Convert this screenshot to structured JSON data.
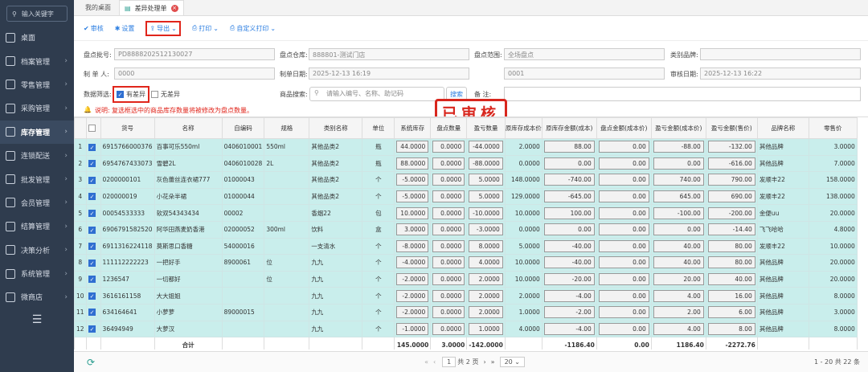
{
  "sidebar": {
    "search_placeholder": "输入关键字",
    "items": [
      {
        "label": "桌面",
        "icon": "monitor-icon",
        "chev": ""
      },
      {
        "label": "档案管理",
        "icon": "file-icon",
        "chev": "›"
      },
      {
        "label": "零售管理",
        "icon": "shop-icon",
        "chev": "›"
      },
      {
        "label": "采购管理",
        "icon": "cart-icon",
        "chev": "›"
      },
      {
        "label": "库存管理",
        "icon": "warehouse-icon",
        "chev": "›"
      },
      {
        "label": "连锁配送",
        "icon": "truck-icon",
        "chev": "›"
      },
      {
        "label": "批发管理",
        "icon": "box-icon",
        "chev": "›"
      },
      {
        "label": "会员管理",
        "icon": "user-icon",
        "chev": "›"
      },
      {
        "label": "结算管理",
        "icon": "wallet-icon",
        "chev": "›"
      },
      {
        "label": "决策分析",
        "icon": "chart-icon",
        "chev": "›"
      },
      {
        "label": "系统管理",
        "icon": "gear-icon",
        "chev": "›"
      },
      {
        "label": "微商店",
        "icon": "store-icon",
        "chev": "›"
      }
    ],
    "collapse": "☰"
  },
  "tabs": [
    {
      "label": "我的桌面"
    },
    {
      "label": "差异处理单"
    }
  ],
  "toolbar": {
    "audit": "审核",
    "settings": "设置",
    "export": "导出",
    "print": "打印",
    "custom_print": "自定义打印"
  },
  "form": {
    "batch_label": "盘点批号:",
    "batch_value": "PD8888202512130027",
    "warehouse_label": "盘点仓库:",
    "warehouse_value": "888801-测试门店",
    "range_label": "盘点范围:",
    "range_value": "全场盘点",
    "brand_label": "类别品牌:",
    "brand_value": "",
    "maker_label": "制 单 人:",
    "maker_value": "0000",
    "date_label": "制单日期:",
    "date_value": "2025-12-13 16:19",
    "auditor_value": "0001",
    "audit_date_label": "审核日期:",
    "audit_date_value": "2025-12-13 16:22",
    "filter_label": "数据筛选:",
    "has_diff": "有差异",
    "no_diff": "无差异",
    "goods_search_label": "商品搜索:",
    "goods_search_placeholder": "请输入编号、名称、助记码",
    "search_btn": "搜索",
    "remark_label": "备    注:",
    "remark_value": "",
    "note_label": "说明:",
    "note_text": "复选框选中的商品库存数量将被修改为盘点数量。",
    "stamp": "已审核"
  },
  "columns": [
    "",
    "货号",
    "名称",
    "自编码",
    "规格",
    "类别名称",
    "单位",
    "系统库存",
    "盘点数量",
    "盈亏数量",
    "原库存成本价",
    "原库存金额(成本)",
    "盘点金额(成本价)",
    "盈亏金额(成本价)",
    "盈亏金额(售价)",
    "品牌名称",
    "零售价"
  ],
  "rows": [
    [
      "1",
      "6915766000376",
      "百事可乐550ml",
      "0406010001",
      "550ml",
      "其他品类2",
      "瓶",
      "44.0000",
      "0.0000",
      "-44.0000",
      "2.0000",
      "88.00",
      "0.00",
      "-88.00",
      "-132.00",
      "其他品牌",
      "3.0000"
    ],
    [
      "2",
      "6954767433073",
      "雪碧2L",
      "0406010028",
      "2L",
      "其他品类2",
      "瓶",
      "88.0000",
      "0.0000",
      "-88.0000",
      "0.0000",
      "0.00",
      "0.00",
      "0.00",
      "-616.00",
      "其他品牌",
      "7.0000"
    ],
    [
      "3",
      "0200000101",
      "灰色蕾丝连衣裙777",
      "01000043",
      "",
      "其他品类2",
      "个",
      "-5.0000",
      "0.0000",
      "5.0000",
      "148.0000",
      "-740.00",
      "0.00",
      "740.00",
      "790.00",
      "发顺丰22",
      "158.0000"
    ],
    [
      "4",
      "020000019",
      "小花朵半裙",
      "01000044",
      "",
      "其他品类2",
      "个",
      "-5.0000",
      "0.0000",
      "5.0000",
      "129.0000",
      "-645.00",
      "0.00",
      "645.00",
      "690.00",
      "发顺丰22",
      "138.0000"
    ],
    [
      "5",
      "00054533333",
      "软双54343434",
      "00002",
      "",
      "香烟22",
      "包",
      "10.0000",
      "0.0000",
      "-10.0000",
      "10.0000",
      "100.00",
      "0.00",
      "-100.00",
      "-200.00",
      "金便uu",
      "20.0000"
    ],
    [
      "6",
      "6906791582520",
      "阿华田燕麦奶香港",
      "02000052",
      "300ml",
      "饮料",
      "盒",
      "3.0000",
      "0.0000",
      "-3.0000",
      "0.0000",
      "0.00",
      "0.00",
      "0.00",
      "-14.40",
      "飞飞哈哈",
      "4.8000"
    ],
    [
      "7",
      "6911316224118",
      "莫斯思口香糖",
      "54000016",
      "",
      "一支清水",
      "个",
      "-8.0000",
      "0.0000",
      "8.0000",
      "5.0000",
      "-40.00",
      "0.00",
      "40.00",
      "80.00",
      "发顺丰22",
      "10.0000"
    ],
    [
      "8",
      "111112222223",
      "一把好手",
      "8900061",
      "位",
      "九九",
      "个",
      "-4.0000",
      "0.0000",
      "4.0000",
      "10.0000",
      "-40.00",
      "0.00",
      "40.00",
      "80.00",
      "其他品牌",
      "20.0000"
    ],
    [
      "9",
      "1236547",
      "一切都好",
      "",
      "位",
      "九九",
      "个",
      "-2.0000",
      "0.0000",
      "2.0000",
      "10.0000",
      "-20.00",
      "0.00",
      "20.00",
      "40.00",
      "其他品牌",
      "20.0000"
    ],
    [
      "10",
      "3616161158",
      "大大姐姐",
      "",
      "",
      "九九",
      "个",
      "-2.0000",
      "0.0000",
      "2.0000",
      "2.0000",
      "-4.00",
      "0.00",
      "4.00",
      "16.00",
      "其他品牌",
      "8.0000"
    ],
    [
      "11",
      "634164641",
      "小萝萝",
      "89000015",
      "",
      "九九",
      "个",
      "-2.0000",
      "0.0000",
      "2.0000",
      "1.0000",
      "-2.00",
      "0.00",
      "2.00",
      "6.00",
      "其他品牌",
      "3.0000"
    ],
    [
      "12",
      "36494949",
      "大萝汉",
      "",
      "",
      "九九",
      "个",
      "-1.0000",
      "0.0000",
      "1.0000",
      "4.0000",
      "-4.00",
      "0.00",
      "4.00",
      "8.00",
      "其他品牌",
      "8.0000"
    ]
  ],
  "totals": {
    "label": "合计",
    "system": "145.0000",
    "counted": "3.0000",
    "diff": "-142.0000",
    "orig_amount": "-1186.40",
    "count_amount": "0.00",
    "diff_amount": "1186.40",
    "diff_sale": "-2272.76"
  },
  "pager": {
    "refresh": "⟳",
    "page": "1",
    "total_pages": "共 2 页",
    "page_size": "20",
    "info": "1 - 20  共 22 条"
  }
}
